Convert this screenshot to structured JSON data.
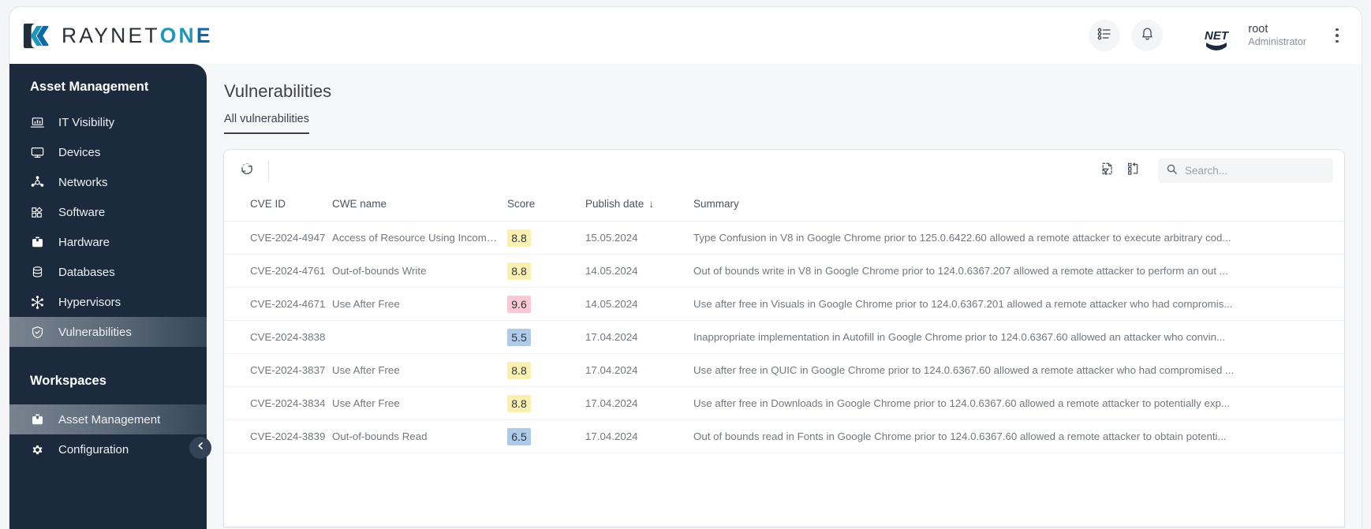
{
  "brand": {
    "name_part1": "RAYNET",
    "name_part2": "ON",
    "name_part3": "E",
    "logo_icon": "raynet-logo-mark",
    "accent_teal": "#1c97b8",
    "accent_blue": "#0c6aa8"
  },
  "header": {
    "list_icon": "list-settings-icon",
    "bell_icon": "notification-bell-icon",
    "avatar_icon": "user-avatar",
    "avatar_text": "NET",
    "user_name": "root",
    "user_role": "Administrator",
    "kebab_icon": "more-vertical-icon"
  },
  "sidebar": {
    "section_title": "Asset Management",
    "items": [
      {
        "label": "IT Visibility",
        "icon": "laptop-chart-icon",
        "active": false
      },
      {
        "label": "Devices",
        "icon": "monitor-icon",
        "active": false
      },
      {
        "label": "Networks",
        "icon": "network-nodes-icon",
        "active": false
      },
      {
        "label": "Software",
        "icon": "shapes-icon",
        "active": false
      },
      {
        "label": "Hardware",
        "icon": "toolbox-icon",
        "active": false
      },
      {
        "label": "Databases",
        "icon": "database-icon",
        "active": false
      },
      {
        "label": "Hypervisors",
        "icon": "snowflake-icon",
        "active": false
      },
      {
        "label": "Vulnerabilities",
        "icon": "shield-check-icon",
        "active": true
      }
    ],
    "workspaces_title": "Workspaces",
    "workspaces": [
      {
        "label": "Asset Management",
        "icon": "briefcase-icon",
        "active": true
      },
      {
        "label": "Configuration",
        "icon": "gear-icon",
        "active": false
      }
    ],
    "collapse_icon": "chevron-left-icon"
  },
  "main": {
    "page_title": "Vulnerabilities",
    "tabs": [
      {
        "label": "All vulnerabilities",
        "active": true
      }
    ],
    "toolbar": {
      "refresh_icon": "refresh-icon",
      "filter_export_icon": "filter-document-icon",
      "columns_icon": "column-layout-icon",
      "search_icon": "search-icon",
      "search_value": "",
      "search_placeholder": "Search..."
    },
    "table": {
      "columns": [
        {
          "key": "cve",
          "label": "CVE ID"
        },
        {
          "key": "cwe",
          "label": "CWE name"
        },
        {
          "key": "score",
          "label": "Score"
        },
        {
          "key": "date",
          "label": "Publish date",
          "sorted": "desc",
          "sort_glyph": "↓"
        },
        {
          "key": "sum",
          "label": "Summary"
        }
      ],
      "rows": [
        {
          "cve": "CVE-2024-4947",
          "cwe": "Access of Resource Using Incompati...",
          "score": "8.8",
          "score_level": "high",
          "date": "15.05.2024",
          "summary": "Type Confusion in V8 in Google Chrome prior to 125.0.6422.60 allowed a remote attacker to execute arbitrary cod..."
        },
        {
          "cve": "CVE-2024-4761",
          "cwe": "Out-of-bounds Write",
          "score": "8.8",
          "score_level": "high",
          "date": "14.05.2024",
          "summary": "Out of bounds write in V8 in Google Chrome prior to 124.0.6367.207 allowed a remote attacker to perform an out ..."
        },
        {
          "cve": "CVE-2024-4671",
          "cwe": "Use After Free",
          "score": "9.6",
          "score_level": "critical",
          "date": "14.05.2024",
          "summary": "Use after free in Visuals in Google Chrome prior to 124.0.6367.201 allowed a remote attacker who had compromis..."
        },
        {
          "cve": "CVE-2024-3838",
          "cwe": "",
          "score": "5.5",
          "score_level": "medium",
          "date": "17.04.2024",
          "summary": "Inappropriate implementation in Autofill in Google Chrome prior to 124.0.6367.60 allowed an attacker who convin..."
        },
        {
          "cve": "CVE-2024-3837",
          "cwe": "Use After Free",
          "score": "8.8",
          "score_level": "high",
          "date": "17.04.2024",
          "summary": "Use after free in QUIC in Google Chrome prior to 124.0.6367.60 allowed a remote attacker who had compromised ..."
        },
        {
          "cve": "CVE-2024-3834",
          "cwe": "Use After Free",
          "score": "8.8",
          "score_level": "high",
          "date": "17.04.2024",
          "summary": "Use after free in Downloads in Google Chrome prior to 124.0.6367.60 allowed a remote attacker to potentially exp..."
        },
        {
          "cve": "CVE-2024-3839",
          "cwe": "Out-of-bounds Read",
          "score": "6.5",
          "score_level": "medium",
          "date": "17.04.2024",
          "summary": "Out of bounds read in Fonts in Google Chrome prior to 124.0.6367.60 allowed a remote attacker to obtain potenti..."
        }
      ]
    }
  }
}
